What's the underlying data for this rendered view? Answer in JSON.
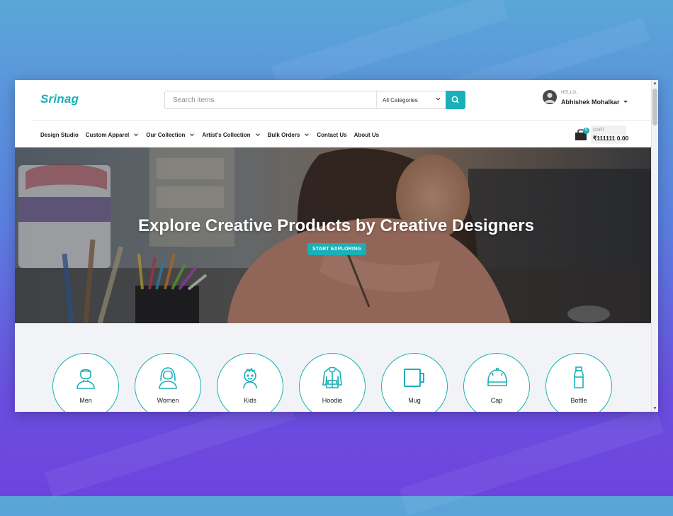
{
  "brand": {
    "logo": "Srinag",
    "accent": "#19b0b8"
  },
  "search": {
    "placeholder": "Search items",
    "category": "All Categories"
  },
  "user": {
    "greeting": "HELLO,",
    "name": "Abhishek Mohalkar"
  },
  "nav": {
    "items": [
      {
        "label": "Design Studio",
        "dropdown": false
      },
      {
        "label": "Custom Apparel",
        "dropdown": true
      },
      {
        "label": "Our Collection",
        "dropdown": true
      },
      {
        "label": "Artist's Collection",
        "dropdown": true
      },
      {
        "label": "Bulk Orders",
        "dropdown": true
      },
      {
        "label": "Contact Us",
        "dropdown": false
      },
      {
        "label": "About Us",
        "dropdown": false
      }
    ]
  },
  "cart": {
    "label": "CART",
    "count": "0",
    "amount": "₹111111 0.00"
  },
  "hero": {
    "title": "Explore Creative Products by Creative Designers",
    "button": "START EXPLORING"
  },
  "categories": [
    {
      "label": "Men",
      "icon": "man-icon"
    },
    {
      "label": "Women",
      "icon": "woman-icon"
    },
    {
      "label": "Kids",
      "icon": "kid-icon"
    },
    {
      "label": "Hoodie",
      "icon": "hoodie-icon"
    },
    {
      "label": "Mug",
      "icon": "mug-icon"
    },
    {
      "label": "Cap",
      "icon": "cap-icon"
    },
    {
      "label": "Bottle",
      "icon": "bottle-icon"
    }
  ]
}
